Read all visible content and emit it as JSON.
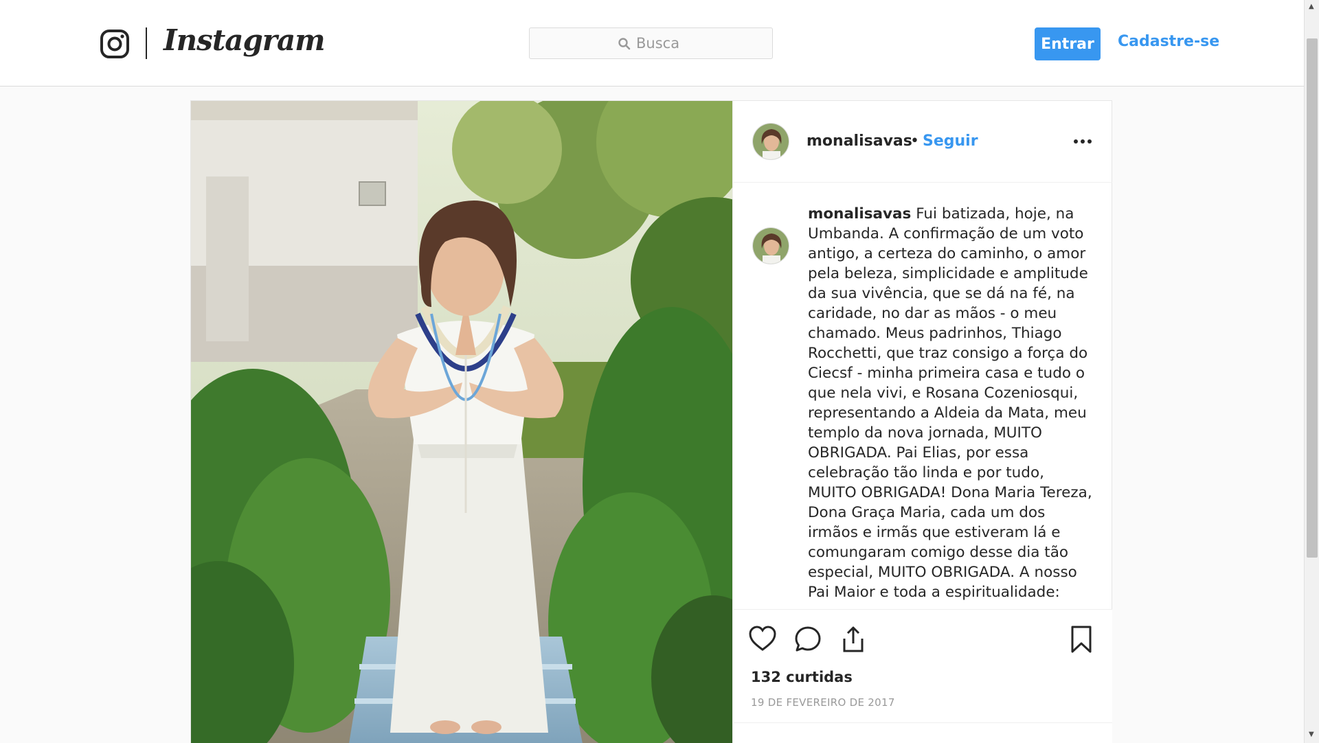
{
  "nav": {
    "brand": "Instagram",
    "search_placeholder": "Busca",
    "login_label": "Entrar",
    "signup_label": "Cadastre-se"
  },
  "post": {
    "username": "monalisavas",
    "separator": "•",
    "follow_label": "Seguir",
    "caption_user": "monalisavas",
    "caption": "Fui batizada, hoje, na Umbanda. A confirmação de um voto antigo, a certeza do caminho, o amor pela beleza, simplicidade e amplitude da sua vivência, que se dá na fé, na caridade, no dar as mãos - o meu chamado. Meus padrinhos, Thiago Rocchetti, que traz consigo a força do Ciecsf - minha primeira casa e tudo o que nela vivi, e Rosana Cozeniosqui, representando a Aldeia da Mata, meu templo da nova jornada, MUITO OBRIGADA. Pai Elias, por essa celebração tão linda e por tudo, MUITO OBRIGADA! Dona Maria Tereza, Dona Graça Maria, cada um dos irmãos e irmãs que estiveram lá e comungaram comigo desse dia tão especial, MUITO OBRIGADA. A nosso Pai Maior e toda a espiritualidade:",
    "likes": "132 curtidas",
    "date": "19 DE FEVEREIRO DE 2017"
  },
  "icons": {
    "brand_glyph": "instagram-glyph-icon",
    "search": "search-icon",
    "more": "more-options-icon",
    "like": "heart-icon",
    "comment": "comment-bubble-icon",
    "share": "share-icon",
    "save": "bookmark-icon"
  },
  "colors": {
    "accent": "#3897f0",
    "text": "#262626",
    "muted": "#999999",
    "border": "#dbdbdb",
    "background": "#fafafa"
  }
}
